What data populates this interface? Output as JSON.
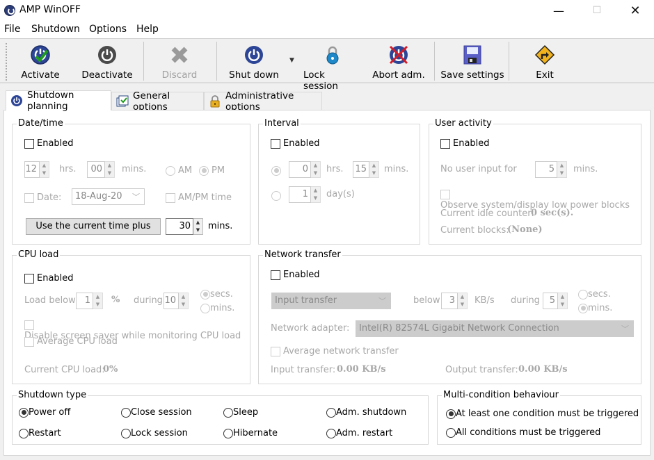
{
  "window": {
    "title": "AMP WinOFF",
    "controls": {
      "minimize": "—",
      "maximize": "☐",
      "close": "✕"
    }
  },
  "menu": [
    "File",
    "Shutdown",
    "Options",
    "Help"
  ],
  "toolbar": {
    "activate": "Activate",
    "deactivate": "Deactivate",
    "discard": "Discard",
    "shutdown": "Shut down",
    "lock_session": "Lock session",
    "abort_adm": "Abort adm.",
    "save_settings": "Save settings",
    "exit": "Exit"
  },
  "tabs": [
    {
      "label": "Shutdown planning",
      "icon": "power-icon",
      "active": true
    },
    {
      "label": "General options",
      "icon": "checklist-icon",
      "active": false
    },
    {
      "label": "Administrative options",
      "icon": "padlock-icon",
      "active": false
    }
  ],
  "datetime": {
    "title": "Date/time",
    "enabled_label": "Enabled",
    "hours": "12",
    "hours_label": "hrs.",
    "minutes": "00",
    "minutes_label": "mins.",
    "am_label": "AM",
    "pm_label": "PM",
    "date_label": "Date:",
    "date_value": "18-Aug-20",
    "ampm_time_label": "AM/PM time",
    "use_current_button": "Use the current time plus",
    "plus_minutes": "30",
    "plus_minutes_label": "mins."
  },
  "interval": {
    "title": "Interval",
    "enabled_label": "Enabled",
    "hours": "0",
    "hours_label": "hrs.",
    "minutes": "15",
    "minutes_label": "mins.",
    "days": "1",
    "days_label": "day(s)"
  },
  "user_activity": {
    "title": "User activity",
    "enabled_label": "Enabled",
    "no_input_label": "No user input for",
    "no_input_value": "5",
    "no_input_unit": "mins.",
    "observe_label": "Observe system/display low power blocks",
    "idle_counter_label": "Current idle counter:",
    "idle_counter_value": "0 sec(s).",
    "blocks_label": "Current blocks:",
    "blocks_value": "(None)"
  },
  "cpu_load": {
    "title": "CPU load",
    "enabled_label": "Enabled",
    "load_below_label": "Load below",
    "load_below_value": "1",
    "percent": "%",
    "during_label": "during",
    "during_value": "10",
    "secs_label": "secs.",
    "mins_label": "mins.",
    "disable_saver_label": "Disable screen saver while monitoring CPU load",
    "average_label": "Average CPU load",
    "current_label": "Current CPU load:",
    "current_value": "0%"
  },
  "network": {
    "title": "Network transfer",
    "enabled_label": "Enabled",
    "direction_value": "Input transfer",
    "below_label": "below",
    "below_value": "3",
    "unit": "KB/s",
    "during_label": "during",
    "during_value": "5",
    "secs_label": "secs.",
    "mins_label": "mins.",
    "adapter_label": "Network adapter:",
    "adapter_value": "Intel(R) 82574L Gigabit Network Connection",
    "average_label": "Average network transfer",
    "input_label": "Input transfer:",
    "input_value": "0.00 KB/s",
    "output_label": "Output transfer:",
    "output_value": "0.00 KB/s"
  },
  "shutdown_type": {
    "title": "Shutdown type",
    "options": [
      {
        "label": "Power off",
        "selected": true
      },
      {
        "label": "Close session",
        "selected": false
      },
      {
        "label": "Sleep",
        "selected": false
      },
      {
        "label": "Adm. shutdown",
        "selected": false
      },
      {
        "label": "Restart",
        "selected": false
      },
      {
        "label": "Lock session",
        "selected": false
      },
      {
        "label": "Hibernate",
        "selected": false
      },
      {
        "label": "Adm. restart",
        "selected": false
      }
    ]
  },
  "multi_condition": {
    "title": "Multi-condition behaviour",
    "options": [
      {
        "label": "At least one condition must be triggered",
        "selected": true
      },
      {
        "label": "All conditions must be triggered",
        "selected": false
      }
    ]
  }
}
